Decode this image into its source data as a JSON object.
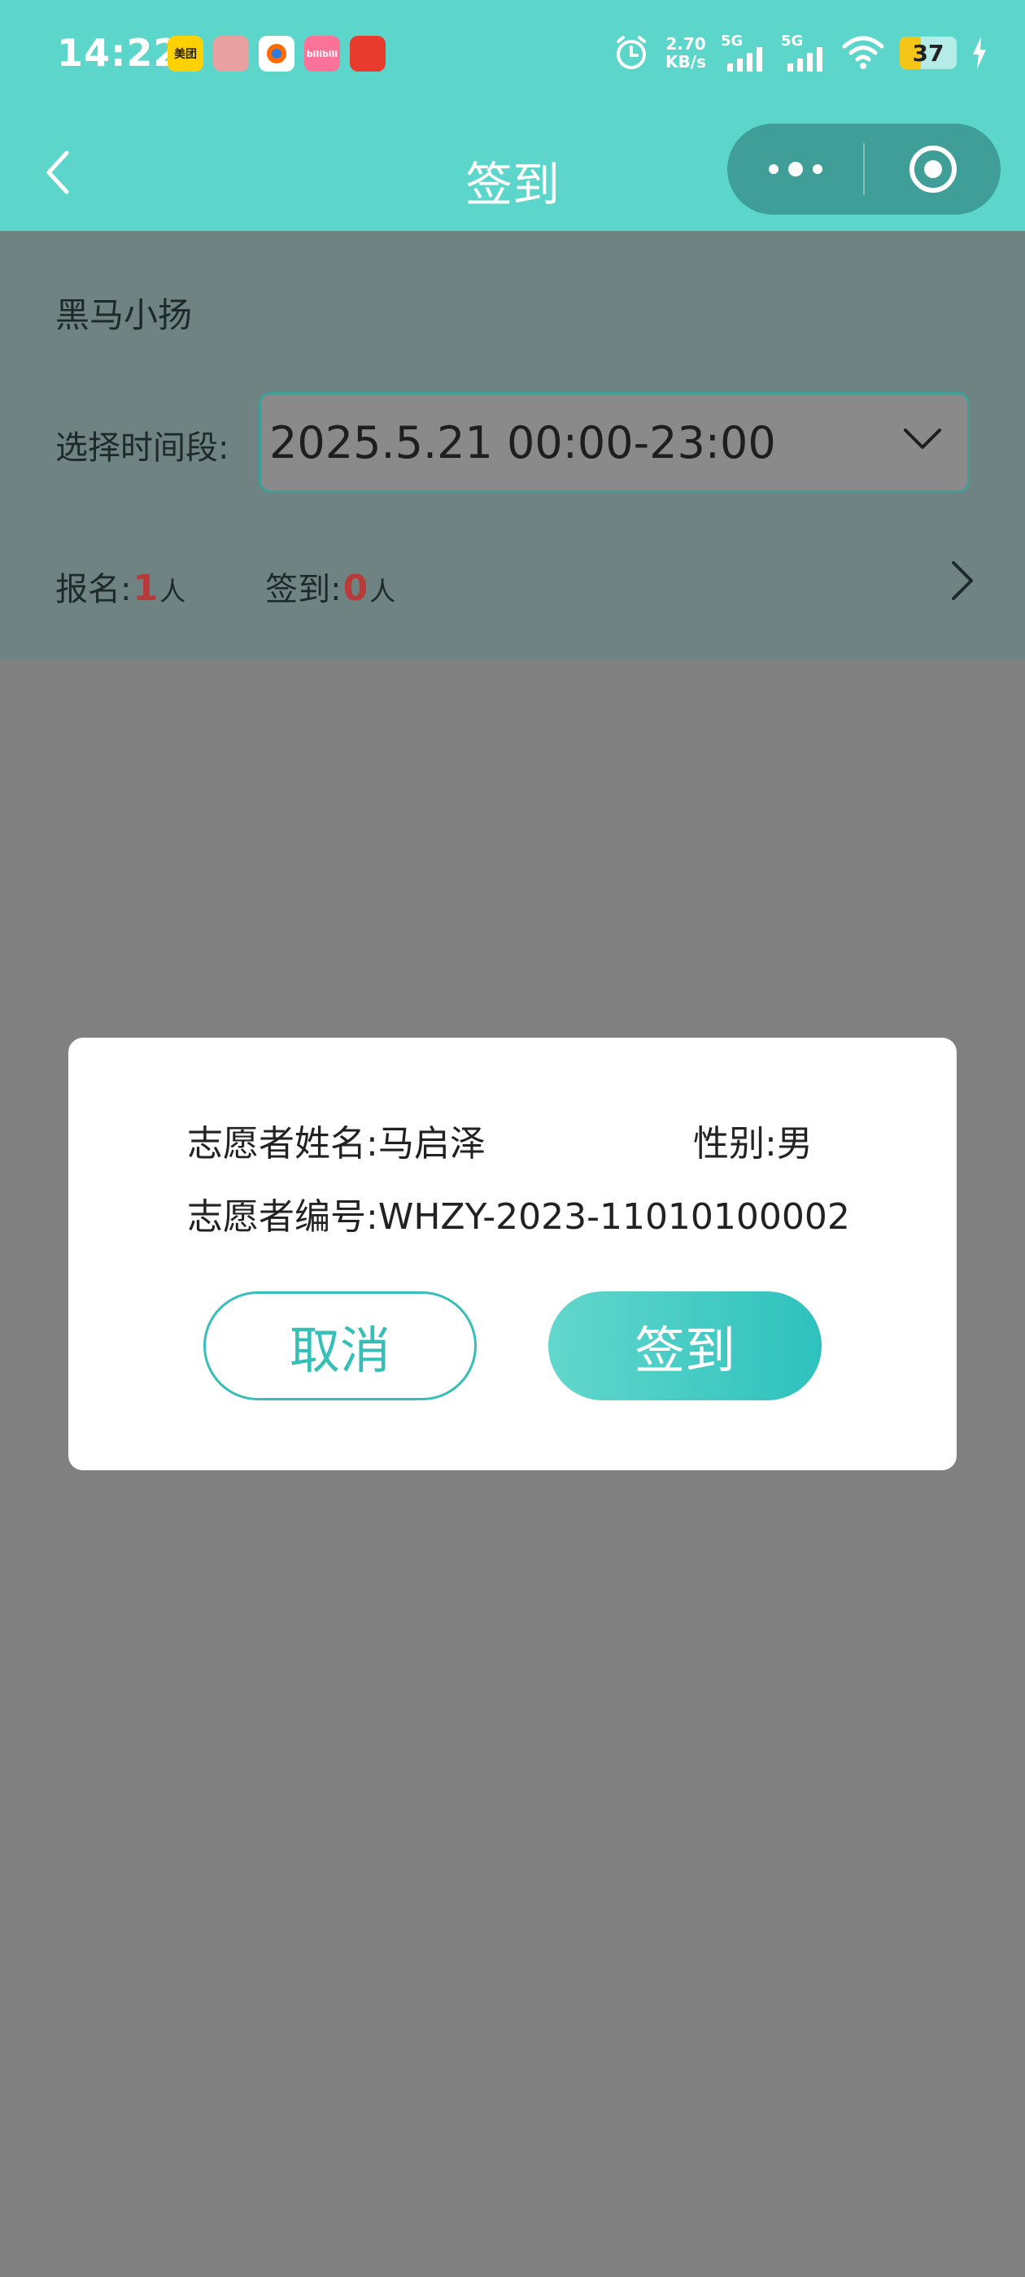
{
  "status_bar": {
    "time": "14:22",
    "notification_icons": [
      {
        "name": "meituan-app-icon",
        "label": "美团",
        "color": "#ffd100"
      },
      {
        "name": "game-app-icon",
        "label": "",
        "color": "#e8a0a0"
      },
      {
        "name": "kuaishou-app-icon",
        "label": "",
        "color": "#ffffff"
      },
      {
        "name": "bilibili-app-icon",
        "label": "bilibili",
        "color": "#fb7299"
      },
      {
        "name": "news-app-icon",
        "label": "",
        "color": "#e83b2e"
      }
    ],
    "net_speed_value": "2.70",
    "net_speed_unit": "KB/s",
    "signal1_label": "5G",
    "signal2_label": "5G",
    "battery_level": "37"
  },
  "nav": {
    "title": "签到"
  },
  "event": {
    "name": "黑马小扬",
    "period_label": "选择时间段:",
    "period_value": "2025.5.21 00:00-23:00",
    "signup_label": "报名:",
    "signup_count": "1",
    "signup_unit": "人",
    "checkin_label": "签到:",
    "checkin_count": "0",
    "checkin_unit": "人"
  },
  "modal": {
    "name_label": "志愿者姓名:",
    "name_value": "马启泽",
    "gender_label": "性别:",
    "gender_value": "男",
    "id_label": "志愿者编号:",
    "id_value": "WHZY-2023-11010100002",
    "cancel_label": "取消",
    "confirm_label": "签到"
  },
  "colors": {
    "accent": "#5cd6cb",
    "accent_dark": "#36bfb7",
    "count_red": "#b83a3a"
  }
}
